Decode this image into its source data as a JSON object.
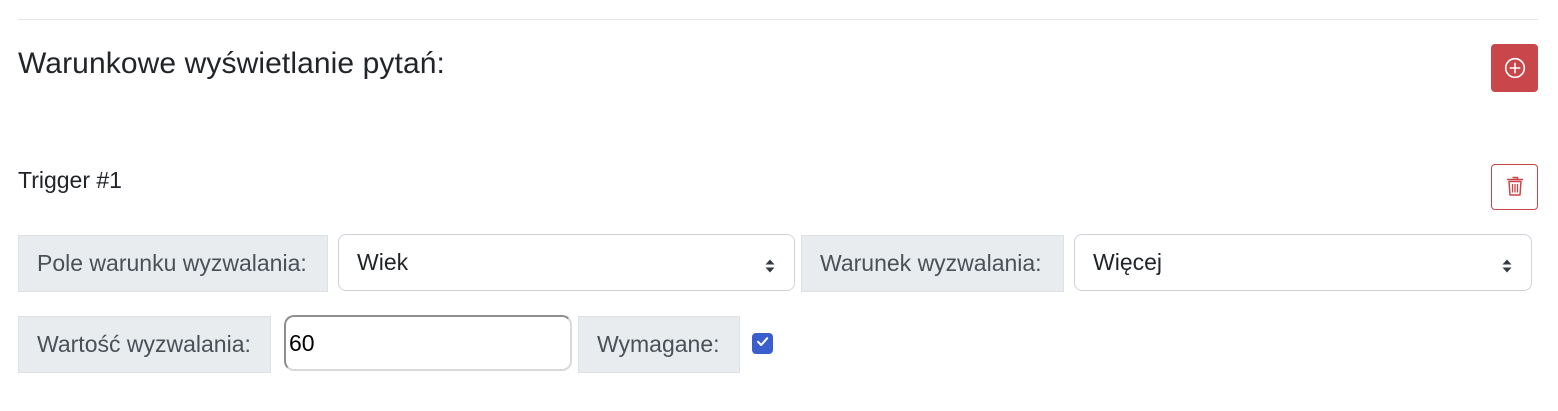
{
  "section": {
    "title": "Warunkowe wyświetlanie pytań:"
  },
  "add_button": {
    "icon": "plus-circle-icon",
    "color": "#c9474a"
  },
  "trigger": {
    "title": "Trigger #1",
    "delete_icon": "trash-icon",
    "field_label": "Pole warunku wyzwalania:",
    "field_value": "Wiek",
    "condition_label": "Warunek wyzwalania:",
    "condition_value": "Więcej",
    "value_label": "Wartość wyzwalania:",
    "value": "60",
    "required_label": "Wymagane:",
    "required_checked": true
  },
  "colors": {
    "danger": "#c9474a",
    "checkbox": "#3a5fcd",
    "label_bg": "#e9ecef"
  }
}
